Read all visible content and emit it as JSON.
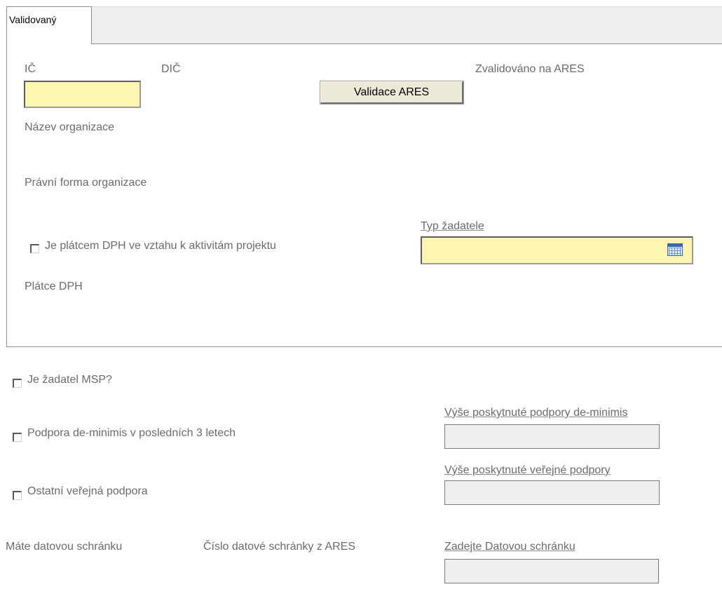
{
  "tab": {
    "label": "Validovaný"
  },
  "company": {
    "ic_label": "IČ",
    "ic_value": "",
    "dic_label": "DIČ",
    "validate_button": "Validace ARES",
    "validated_label": "Zvalidováno na ARES",
    "org_name_label": "Název organizace",
    "legal_form_label": "Právní forma organizace",
    "vat_checkbox_label": "Je plátcem DPH ve vztahu k aktivitám projektu",
    "vat_checked": false,
    "applicant_type_label": "Typ žadatele",
    "applicant_type_value": "",
    "vat_payer_label": "Plátce DPH"
  },
  "support": {
    "msp_label": "Je žadatel MSP?",
    "msp_checked": false,
    "deminimis_label": "Podpora de-minimis v posledních 3 letech",
    "deminimis_checked": false,
    "deminimis_amount_label": "Výše poskytnuté podpory de-minimis",
    "deminimis_amount_value": "",
    "public_support_label": "Ostatní veřejná podpora",
    "public_support_checked": false,
    "public_amount_label": "Výše poskytnuté veřejné podpory",
    "public_amount_value": ""
  },
  "databox": {
    "has_databox_label": "Máte datovou schránku",
    "ares_databox_label": "Číslo datové schránky z ARES",
    "enter_databox_label": "Zadejte Datovou schránku",
    "databox_value": ""
  },
  "icons": {
    "calendar": "calendar-icon"
  },
  "colors": {
    "required_field": "#fff5b2",
    "readonly_field": "#efefef",
    "button": "#ede9d8"
  }
}
